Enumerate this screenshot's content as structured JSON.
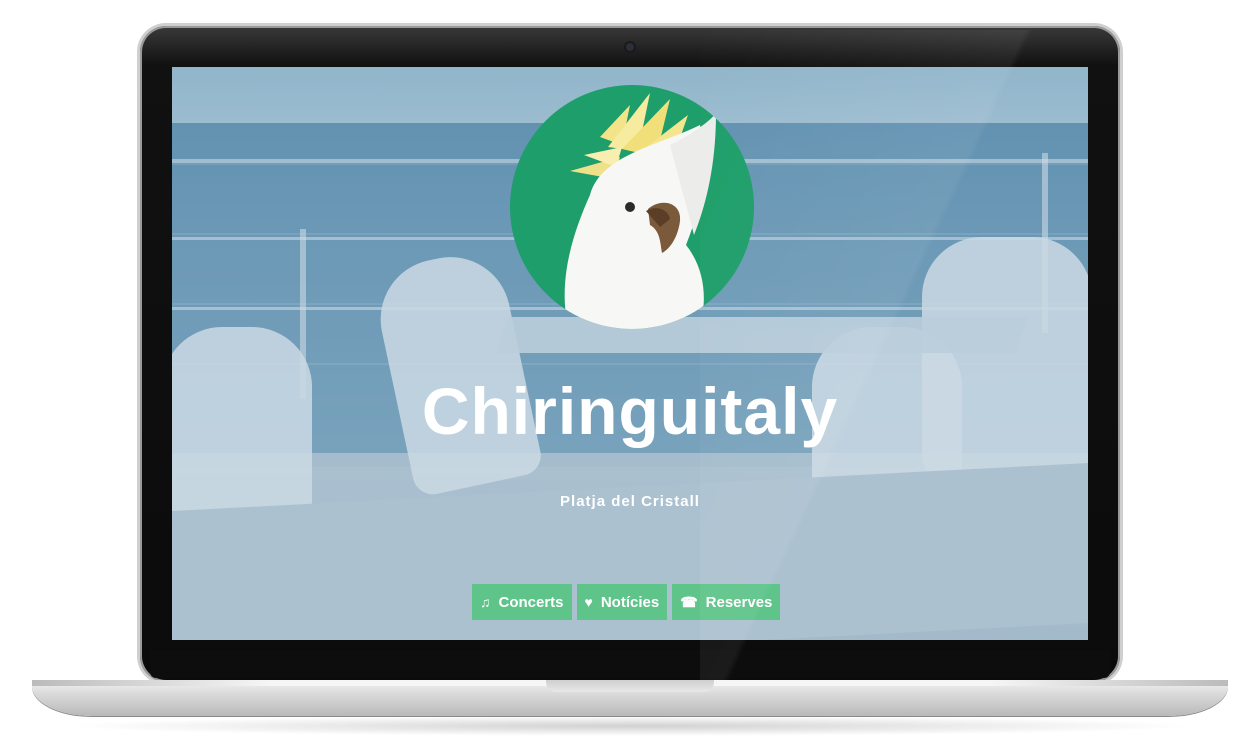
{
  "site": {
    "title": "Chiringuitaly",
    "subtitle": "Platja del Cristall"
  },
  "logo": {
    "icon": "cockatoo-icon",
    "background": "#1e9e6a"
  },
  "nav": [
    {
      "icon": "music-note-icon",
      "glyph": "♫",
      "label": "Concerts"
    },
    {
      "icon": "heart-icon",
      "glyph": "♥",
      "label": "Notícies"
    },
    {
      "icon": "phone-icon",
      "glyph": "☎",
      "label": "Reserves"
    }
  ],
  "colors": {
    "accent": "#5ec489",
    "text": "#ffffff"
  }
}
